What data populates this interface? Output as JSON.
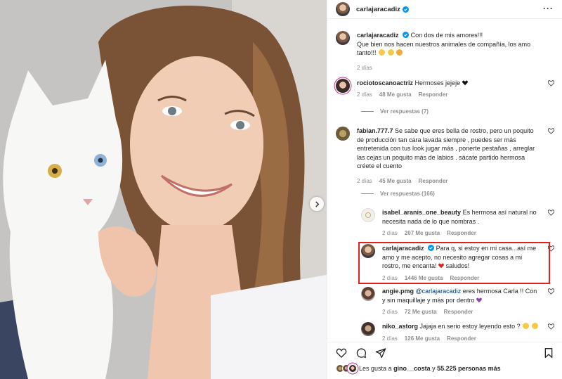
{
  "post": {
    "author": "carlajaracadiz",
    "caption_line1": "Con dos de mis amores!!!",
    "caption_line2": "Que bien nos hacen nuestros animales de compañía, los amo",
    "caption_line3": "tanto!!!",
    "caption_emojis": [
      "smiling-face-with-hearts",
      "smiling-face-with-hearts",
      "smiling-cat-with-heart-eyes"
    ],
    "age": "2 días"
  },
  "comments": [
    {
      "user": "rociotoscanoactriz",
      "text": "Hermoses jejeje",
      "emoji": "black-heart",
      "age": "2 días",
      "likes": "48 Me gusta",
      "reply": "Responder",
      "view_replies": "Ver respuestas (7)"
    },
    {
      "user": "fabian.777.7",
      "lines": [
        "Se sabe que eres bella de rostro, pero un poquito",
        "de producción tan cara lavada siempre , puedes ser más",
        "entretenida con tus look jugar más , ponerte pestañas , arreglar",
        "las cejas un poquito más de labios . sácate partido hermosa",
        "créete el cuento"
      ],
      "age": "2 días",
      "likes": "45 Me gusta",
      "reply": "Responder",
      "view_replies": "Ver respuestas (166)"
    }
  ],
  "replies": [
    {
      "user": "isabel_aranis_one_beauty",
      "lines": [
        "Es hermosa así natural no",
        "necesita nada de lo que nombras ."
      ],
      "age": "2 días",
      "likes": "207 Me gusta",
      "reply": "Responder"
    },
    {
      "user": "carlajaracadiz",
      "lines": [
        "Para q, si estoy en mi casa...así me",
        "amo y me acepto, no necesito agregar cosas a mi",
        "rostro, me encanta!",
        " saludos!"
      ],
      "emoji": "red-heart",
      "age": "2 días",
      "likes": "1446 Me gusta",
      "reply": "Responder"
    },
    {
      "user": "angie.pmg",
      "mention": "@carlajaracadiz",
      "lines": [
        "eres hermosa Carla !! Con",
        "y sin maquillaje y más por dentro"
      ],
      "emoji": "purple-heart",
      "age": "2 días",
      "likes": "72 Me gusta",
      "reply": "Responder"
    },
    {
      "user": "niko_astorg",
      "lines": [
        "Jajaja en serio estoy leyendo esto ?"
      ],
      "emojis": [
        "grinning-squinting-face",
        "grinning-squinting-face"
      ],
      "age": "2 días",
      "likes": "126 Me gusta",
      "reply": "Responder"
    }
  ],
  "likes_line": {
    "prefix": "Les gusta a",
    "first": "gino__costa",
    "connector": "y",
    "count": "55.225 personas más"
  },
  "colors": {
    "verified": "#0095f6",
    "highlight": "#e0211d",
    "meta": "#8e8e8e",
    "mention": "#00376b"
  }
}
